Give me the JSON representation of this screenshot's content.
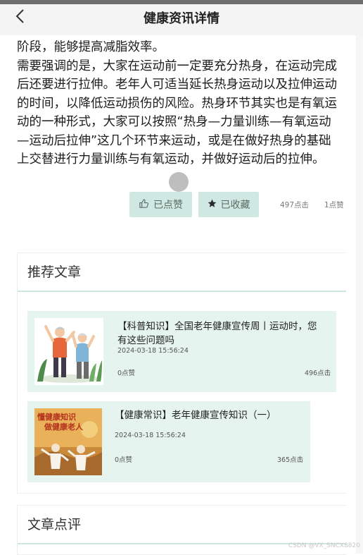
{
  "header": {
    "title": "健康资讯详情",
    "back_icon": "chevron-left-icon"
  },
  "article": {
    "paragraphs": [
      "阶段，能够提高减脂效率。",
      "需要强调的是，大家在运动前一定要充分热身，在运动完成后还要进行拉伸。老年人可适当延长热身运动以及拉伸运动的时间，以降低运动损伤的风险。热身环节其实也是有氧运动的一种形式，大家可以按照“热身—力量训练—有氧运动—运动后拉伸”这几个环节来运动，或是在做好热身的基础上交替进行力量训练与有氧运动，并做好运动后的拉伸。"
    ]
  },
  "actions": {
    "like_label": "已点赞",
    "like_icon": "thumbs-up-icon",
    "favorite_label": "已收藏",
    "favorite_icon": "star-icon",
    "clicks": "497点击",
    "likes": "1点赞",
    "button_bg": "#cfe9e2"
  },
  "recommend": {
    "title": "推荐文章",
    "items": [
      {
        "title": "【科普知识】全国老年健康宣传周丨运动时，您有这些问题吗",
        "date": "2024-03-18 15:56:24",
        "likes": "0点赞",
        "clicks": "496点击"
      },
      {
        "title": "【健康常识】老年健康宣传知识（一）",
        "date": "2024-03-18 15:56:24",
        "likes": "0点赞",
        "clicks": "365点击",
        "thumb_text_1": "懂健康知识",
        "thumb_text_2": "做健康老人"
      }
    ]
  },
  "comments": {
    "title": "文章点评"
  },
  "watermark": "CSDN @VX_SNCX8820",
  "colors": {
    "accent_light": "#e5f4ef",
    "divider": "#cfe6df"
  }
}
